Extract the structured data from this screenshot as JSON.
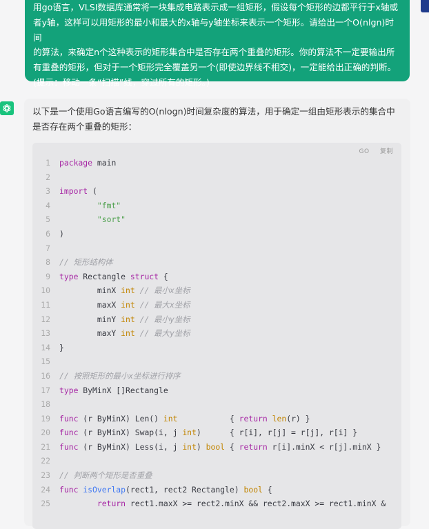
{
  "user_message": {
    "lines": [
      "用go语言，VLSI数据库通常将一块集成电路表示成一组矩形，假设每个矩形的边都平行于x轴或",
      "者y轴，这样可以用矩形的最小和最大的x轴与y轴坐标来表示一个矩形。请给出一个O(nlgn)时间",
      "的算法，来确定n个这种表示的矩形集合中是否存在两个重叠的矩形。你的算法不一定要输出所",
      "有重叠的矩形，但对于一个矩形完全覆盖另一个(即使边界线不相交)，一定能给出正确的判断。",
      "(提示：移动一条“扫描”线，穿过所有的矩形。)"
    ]
  },
  "assistant": {
    "avatar_icon": "openai-icon",
    "intro_lines": [
      "以下是一个使用Go语言编写的O(nlogn)时间复杂度的算法，用于确定一组由矩形表示的集合中",
      "是否存在两个重叠的矩形："
    ]
  },
  "code_block": {
    "language": "GO",
    "copy_label": "复制",
    "lines": [
      {
        "n": "1",
        "text": "package main"
      },
      {
        "n": "2",
        "text": ""
      },
      {
        "n": "3",
        "text": "import ("
      },
      {
        "n": "4",
        "text": "        \"fmt\""
      },
      {
        "n": "5",
        "text": "        \"sort\""
      },
      {
        "n": "6",
        "text": ")"
      },
      {
        "n": "7",
        "text": ""
      },
      {
        "n": "8",
        "text": "// 矩形结构体"
      },
      {
        "n": "9",
        "text": "type Rectangle struct {"
      },
      {
        "n": "10",
        "text": "        minX int // 最小x坐标"
      },
      {
        "n": "11",
        "text": "        maxX int // 最大x坐标"
      },
      {
        "n": "12",
        "text": "        minY int // 最小y坐标"
      },
      {
        "n": "13",
        "text": "        maxY int // 最大y坐标"
      },
      {
        "n": "14",
        "text": "}"
      },
      {
        "n": "15",
        "text": ""
      },
      {
        "n": "16",
        "text": "// 按照矩形的最小x坐标进行排序"
      },
      {
        "n": "17",
        "text": "type ByMinX []Rectangle"
      },
      {
        "n": "18",
        "text": ""
      },
      {
        "n": "19",
        "text": "func (r ByMinX) Len() int           { return len(r) }"
      },
      {
        "n": "20",
        "text": "func (r ByMinX) Swap(i, j int)      { r[i], r[j] = r[j], r[i] }"
      },
      {
        "n": "21",
        "text": "func (r ByMinX) Less(i, j int) bool { return r[i].minX < r[j].minX }"
      },
      {
        "n": "22",
        "text": ""
      },
      {
        "n": "23",
        "text": "// 判断两个矩形是否重叠"
      },
      {
        "n": "24",
        "text": "func isOverlap(rect1, rect2 Rectangle) bool {"
      },
      {
        "n": "25",
        "text": "        return rect1.maxX >= rect2.minX && rect2.maxX >= rect1.minX &"
      }
    ]
  }
}
